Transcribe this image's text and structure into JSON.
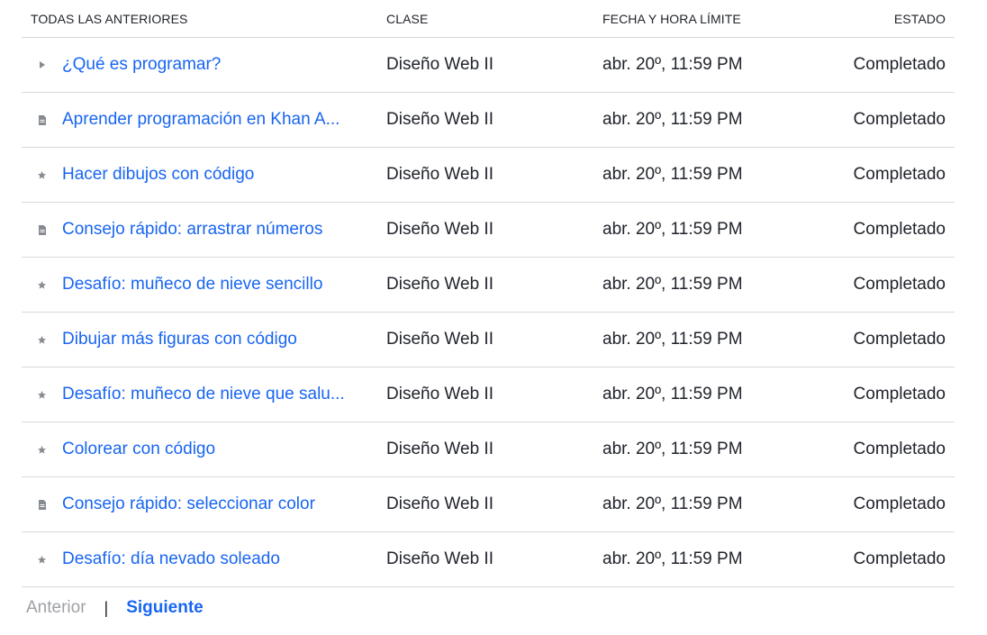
{
  "header": {
    "title": "TODAS LAS ANTERIORES",
    "class": "CLASE",
    "due": "FECHA Y HORA LÍMITE",
    "status": "ESTADO"
  },
  "rows": [
    {
      "icon": "play-icon",
      "title": "¿Qué es programar?",
      "class": "Diseño Web II",
      "due": "abr. 20º, 11:59 PM",
      "status": "Completado"
    },
    {
      "icon": "article-icon",
      "title": "Aprender programación en Khan A...",
      "class": "Diseño Web II",
      "due": "abr. 20º, 11:59 PM",
      "status": "Completado"
    },
    {
      "icon": "star-icon",
      "title": "Hacer dibujos con código",
      "class": "Diseño Web II",
      "due": "abr. 20º, 11:59 PM",
      "status": "Completado"
    },
    {
      "icon": "article-icon",
      "title": "Consejo rápido: arrastrar números",
      "class": "Diseño Web II",
      "due": "abr. 20º, 11:59 PM",
      "status": "Completado"
    },
    {
      "icon": "star-icon",
      "title": "Desafío: muñeco de nieve sencillo",
      "class": "Diseño Web II",
      "due": "abr. 20º, 11:59 PM",
      "status": "Completado"
    },
    {
      "icon": "star-icon",
      "title": "Dibujar más figuras con código",
      "class": "Diseño Web II",
      "due": "abr. 20º, 11:59 PM",
      "status": "Completado"
    },
    {
      "icon": "star-icon",
      "title": "Desafío: muñeco de nieve que salu...",
      "class": "Diseño Web II",
      "due": "abr. 20º, 11:59 PM",
      "status": "Completado"
    },
    {
      "icon": "star-icon",
      "title": "Colorear con código",
      "class": "Diseño Web II",
      "due": "abr. 20º, 11:59 PM",
      "status": "Completado"
    },
    {
      "icon": "article-icon",
      "title": "Consejo rápido: seleccionar color",
      "class": "Diseño Web II",
      "due": "abr. 20º, 11:59 PM",
      "status": "Completado"
    },
    {
      "icon": "star-icon",
      "title": "Desafío: día nevado soleado",
      "class": "Diseño Web II",
      "due": "abr. 20º, 11:59 PM",
      "status": "Completado"
    }
  ],
  "pager": {
    "prev": "Anterior",
    "separator": "|",
    "next": "Siguiente"
  },
  "colors": {
    "link": "#1865f2",
    "disabled": "#9ea0a6",
    "icon": "#868a91",
    "divider": "#d6d8da"
  }
}
